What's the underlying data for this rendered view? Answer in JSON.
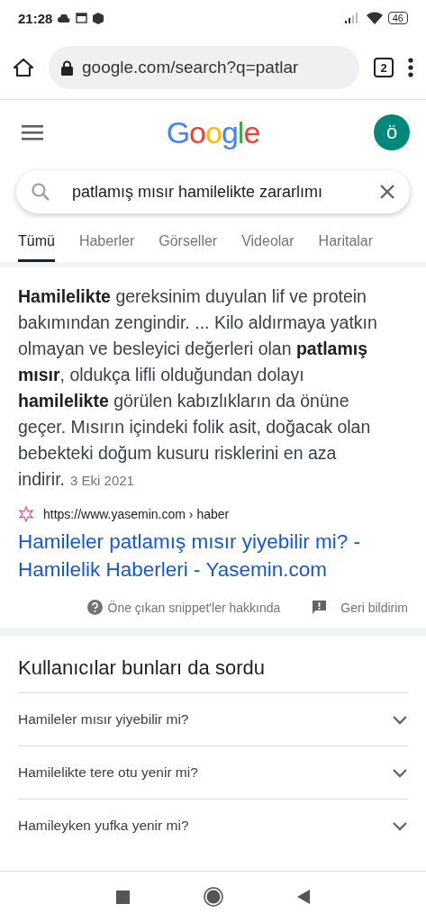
{
  "status_bar": {
    "time": "21:28",
    "battery": "46"
  },
  "browser": {
    "url": "google.com/search?q=patlar",
    "tab_count": "2"
  },
  "header": {
    "logo": "Google",
    "avatar": "ö"
  },
  "search": {
    "value": "patlamış mısır hamilelikte zararlımı"
  },
  "tabs": [
    {
      "label": "Tümü",
      "selected": true
    },
    {
      "label": "Haberler",
      "selected": false
    },
    {
      "label": "Görseller",
      "selected": false
    },
    {
      "label": "Videolar",
      "selected": false
    },
    {
      "label": "Haritalar",
      "selected": false
    }
  ],
  "snippet": {
    "text": "**Hamilelikte** gereksinim duyulan lif ve protein bakımından zengindir. ... Kilo aldırmaya yatkın olmayan ve besleyici değerleri olan **patlamış mısır**, oldukça lifli olduğundan dolayı **hamilelikte** görülen kabızlıkların da önüne geçer. Mısırın içindeki folik asit, doğacak olan bebekteki doğum kusuru risklerini en aza indirir.",
    "date": "3 Eki 2021",
    "source_url": "https://www.yasemin.com › haber",
    "title": "Hamileler patlamış mısır yiyebilir mi? - Hamilelik Haberleri - Yasemin.com",
    "about": "Öne çıkan snippet'ler hakkında",
    "feedback": "Geri bildirim"
  },
  "related": {
    "title": "Kullanıcılar bunları da sordu",
    "questions": [
      {
        "text": "Hamileler mısır yiyebilir mi?",
        "expanded": false
      },
      {
        "text": "Hamilelikte tere otu yenir mi?",
        "expanded": false
      },
      {
        "text": "Hamileyken yufka yenir mi?",
        "expanded": false
      }
    ]
  }
}
